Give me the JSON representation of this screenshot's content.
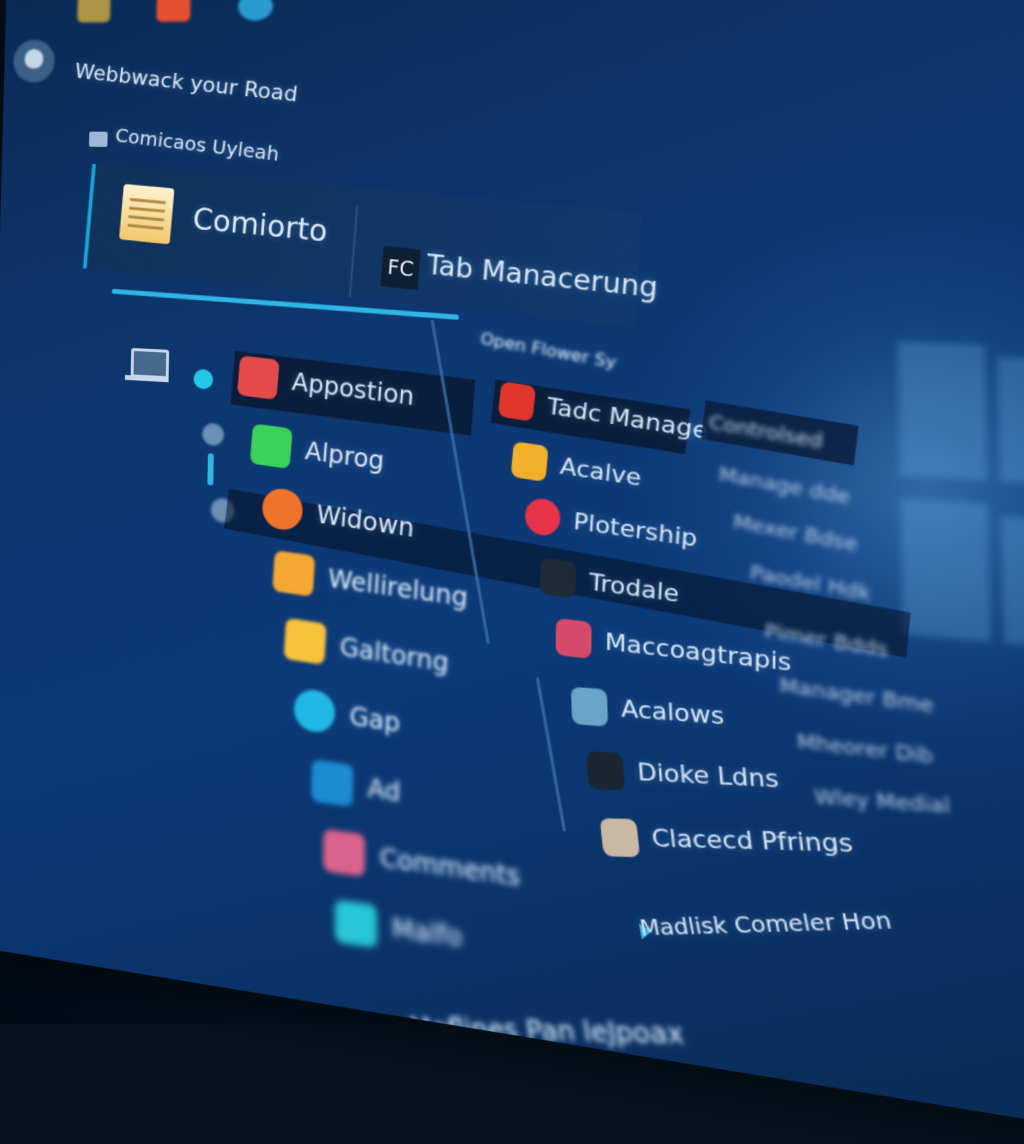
{
  "header": {
    "title": "Webbwack your Road",
    "section_label": "Comicaos Uyleah"
  },
  "tabs": [
    {
      "label": "Comiorto",
      "icon": "notes-icon"
    },
    {
      "badge": "FC",
      "label": "Tab Manacerung"
    }
  ],
  "left_list": {
    "items": [
      {
        "label": "Appostion",
        "icon": "red-app-icon",
        "color": "#e44b4b",
        "selected": true
      },
      {
        "label": "Alprog",
        "icon": "green-a-icon",
        "color": "#3bd15a"
      },
      {
        "label": "Widown",
        "icon": "orange-circle-icon",
        "color": "#f0732a"
      },
      {
        "label": "Wellirelung",
        "icon": "photo-icon",
        "color": "#f4a832"
      },
      {
        "label": "Galtorng",
        "icon": "folder-icon",
        "color": "#f7c23c"
      },
      {
        "label": "Gap",
        "icon": "cyan-circle-icon",
        "color": "#21b7e6"
      },
      {
        "label": "Ad",
        "icon": "blue-square-icon",
        "color": "#1c8bd3"
      },
      {
        "label": "Comments",
        "icon": "pink-app-icon",
        "color": "#d9628c"
      },
      {
        "label": "Malfo",
        "icon": "teal-app-icon",
        "color": "#27c6d6"
      }
    ]
  },
  "middle_list": {
    "header": "Open Flower Sy",
    "items": [
      {
        "label": "Tadc Manage",
        "icon": "red-tile-icon",
        "color": "#e0352b",
        "selected": true
      },
      {
        "label": "Acalve",
        "icon": "chart-icon",
        "color": "#f3b02c"
      },
      {
        "label": "Plotership",
        "icon": "red-dot-icon",
        "color": "#e8334a"
      },
      {
        "label": "Trodale",
        "icon": "dark-grid-icon",
        "color": "#1f2a38"
      },
      {
        "label": "Maccoagtrapis",
        "icon": "pink-frame-icon",
        "color": "#d64a6a"
      },
      {
        "label": "Acalows",
        "icon": "map-icon",
        "color": "#6aa4c8"
      },
      {
        "label": "Dioke Ldns",
        "icon": "wave-icon",
        "color": "#1b2633"
      },
      {
        "label": "Clacecd Pfrings",
        "icon": "person-icon",
        "color": "#c9b9a3"
      }
    ]
  },
  "right_list": {
    "header": "Controlsed",
    "items": [
      "Manage dde",
      "Mexer Bdse",
      "Paodel Hdk",
      "Pimer Bdds",
      "Manager Bme",
      "Mheorer Dib",
      "Wley Medial"
    ]
  },
  "footer": {
    "link": "Madlisk Comeler Hon",
    "bottom": "Maflines Pan leJpoax"
  },
  "colors": {
    "accent": "#2fb6e6",
    "screen_bg": "#0d3770",
    "text": "#dbe8f7"
  }
}
